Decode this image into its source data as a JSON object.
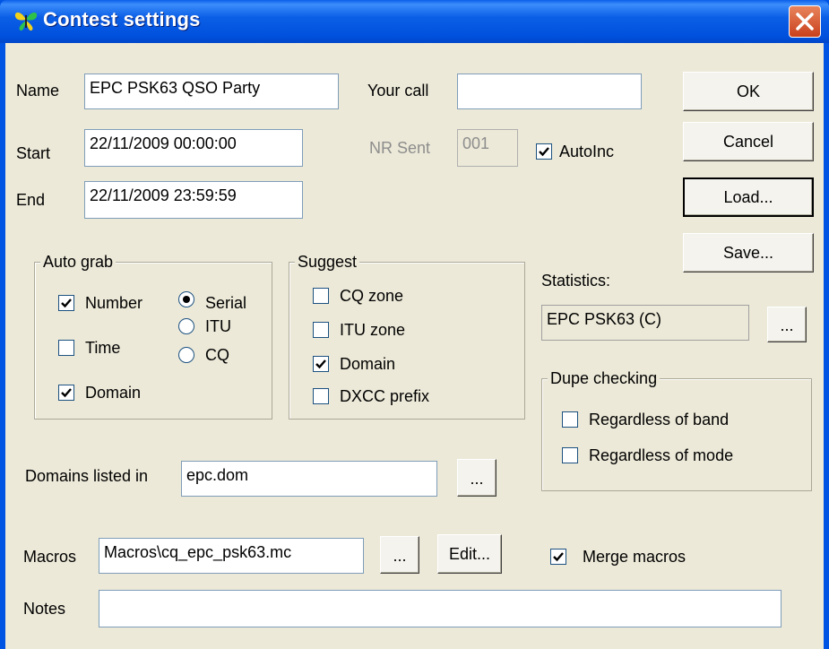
{
  "window": {
    "title": "Contest settings"
  },
  "fields": {
    "name_label": "Name",
    "name_value": "EPC PSK63 QSO Party",
    "your_call_label": "Your call",
    "your_call_value": "",
    "start_label": "Start",
    "start_value": "22/11/2009 00:00:00",
    "end_label": "End",
    "end_value": "22/11/2009 23:59:59",
    "nr_sent_label": "NR Sent",
    "nr_sent_value": "001",
    "autoinc_label": "AutoInc",
    "autoinc_checked": true
  },
  "buttons": {
    "ok": "OK",
    "cancel": "Cancel",
    "load": "Load...",
    "save": "Save..."
  },
  "auto_grab": {
    "title": "Auto grab",
    "number": "Number",
    "number_checked": true,
    "time": "Time",
    "time_checked": false,
    "domain": "Domain",
    "domain_checked": true,
    "serial": "Serial",
    "itu": "ITU",
    "cq": "CQ",
    "selected": "Serial"
  },
  "suggest": {
    "title": "Suggest",
    "cq_zone": "CQ zone",
    "itu_zone": "ITU zone",
    "domain": "Domain",
    "dxcc_prefix": "DXCC prefix",
    "checked": [
      "Domain"
    ]
  },
  "statistics": {
    "label": "Statistics:",
    "value": "EPC PSK63 (C)",
    "browse": "..."
  },
  "dupe": {
    "title": "Dupe checking",
    "band": "Regardless of band",
    "mode": "Regardless of mode"
  },
  "domains": {
    "label": "Domains listed in",
    "value": "epc.dom",
    "browse": "..."
  },
  "macros": {
    "label": "Macros",
    "value": "Macros\\cq_epc_psk63.mc",
    "browse": "...",
    "edit": "Edit...",
    "merge": "Merge macros",
    "merge_checked": true
  },
  "notes": {
    "label": "Notes",
    "value": ""
  }
}
